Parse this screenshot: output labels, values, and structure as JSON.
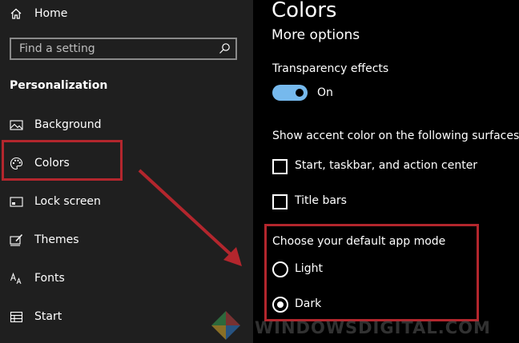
{
  "sidebar": {
    "home_label": "Home",
    "search_placeholder": "Find a setting",
    "section_title": "Personalization",
    "items": [
      {
        "label": "Background",
        "icon": "picture-icon"
      },
      {
        "label": "Colors",
        "icon": "palette-icon"
      },
      {
        "label": "Lock screen",
        "icon": "lock-screen-icon"
      },
      {
        "label": "Themes",
        "icon": "themes-icon"
      },
      {
        "label": "Fonts",
        "icon": "fonts-icon"
      },
      {
        "label": "Start",
        "icon": "start-icon"
      }
    ]
  },
  "main": {
    "title": "Colors",
    "subheading": "More options",
    "transparency": {
      "label": "Transparency effects",
      "state_label": "On",
      "on": true
    },
    "accent": {
      "label": "Show accent color on the following surfaces",
      "options": [
        {
          "label": "Start, taskbar, and action center",
          "checked": false
        },
        {
          "label": "Title bars",
          "checked": false
        }
      ]
    },
    "app_mode": {
      "label": "Choose your default app mode",
      "options": [
        {
          "label": "Light",
          "selected": false
        },
        {
          "label": "Dark",
          "selected": true
        }
      ]
    }
  },
  "watermark": "WINDOWSDIGITAL.COM",
  "colors": {
    "sidebar_bg": "#1f1f1f",
    "main_bg": "#000000",
    "toggle_on": "#76b9ed",
    "highlight": "#b3262d"
  }
}
